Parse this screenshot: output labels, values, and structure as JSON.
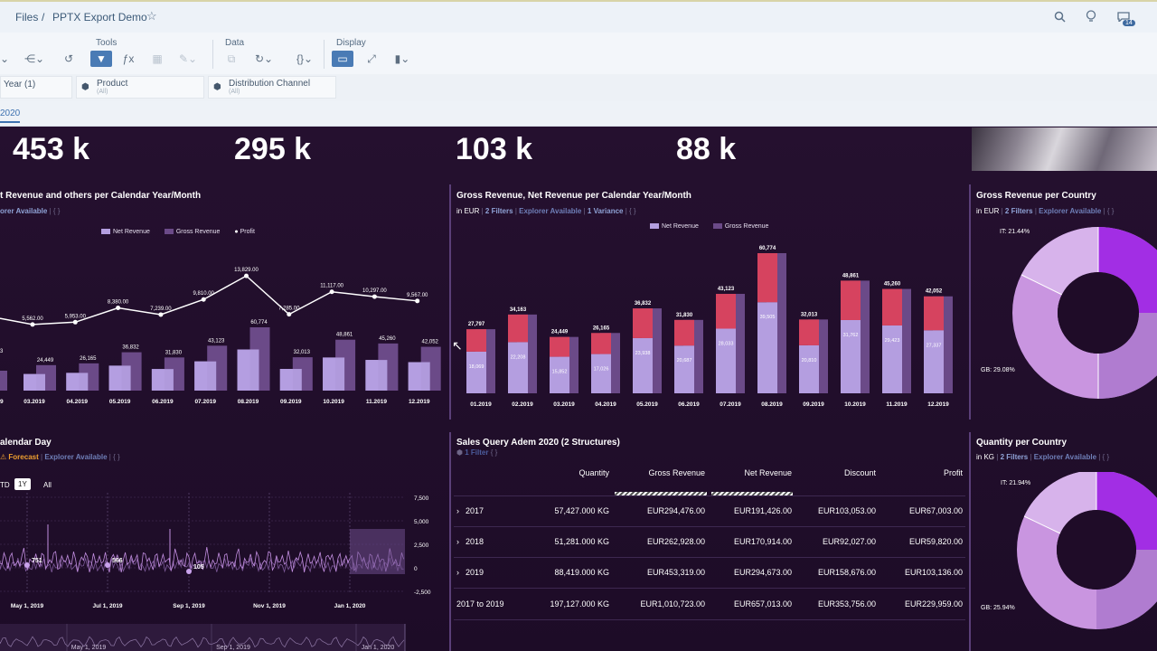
{
  "breadcrumb": {
    "root": "Files",
    "sep": "/",
    "current": "PPTX Export Demo"
  },
  "header_icons": [
    "search-icon",
    "lightbulb-icon",
    "notifications-icon"
  ],
  "notification_count": "14",
  "toolbar": {
    "tools_label": "Tools",
    "data_label": "Data",
    "display_label": "Display"
  },
  "filters": [
    {
      "title": "Year (1)",
      "sub": ""
    },
    {
      "title": "Product",
      "sub": "(All)"
    },
    {
      "title": "Distribution Channel",
      "sub": "(All)"
    }
  ],
  "page_tab": "2020",
  "kpis": [
    "453 k",
    "295 k",
    "103 k",
    "88 k"
  ],
  "widget1": {
    "title": "t Revenue and others per Calendar Year/Month",
    "sub_explorer": "orer Available",
    "legend": [
      "Net Revenue",
      "Gross Revenue",
      "Profit"
    ]
  },
  "widget2": {
    "title": "Gross Revenue, Net Revenue per Calendar Year/Month",
    "unit": "in EUR",
    "filters": "2 Filters",
    "explorer": "Explorer Available",
    "variance": "1 Variance",
    "legend": [
      "Net Revenue",
      "Gross Revenue"
    ]
  },
  "widget3": {
    "title": "Gross Revenue per Country",
    "unit": "in EUR",
    "filters": "2 Filters",
    "explorer": "Explorer Available",
    "labels": [
      "IT: 21.44%",
      "GB: 29.08%"
    ]
  },
  "widget4": {
    "title": "alendar Day",
    "forecast": "Forecast",
    "explorer": "Explorer Available",
    "ranges": [
      "TD",
      "1Y",
      "All"
    ],
    "y_ticks": [
      "7,500",
      "5,000",
      "2,500",
      "0",
      "-2,500"
    ],
    "x_ticks": [
      "May 1, 2019",
      "Jul 1, 2019",
      "Sep 1, 2019",
      "Nov 1, 2019",
      "Jan 1, 2020"
    ],
    "nav_ticks": [
      "May 1, 2019",
      "Sep 1, 2019",
      "Jan 1, 2020"
    ],
    "points": [
      "751",
      "566",
      "105"
    ]
  },
  "widget5": {
    "title": "Sales Query Adem 2020 (2 Structures)",
    "filter": "1 Filter",
    "columns": [
      "Quantity",
      "Gross Revenue",
      "Net Revenue",
      "Discount",
      "Profit"
    ],
    "rows": [
      {
        "label": "2017",
        "cells": [
          "57,427.000 KG",
          "EUR294,476.00",
          "EUR191,426.00",
          "EUR103,053.00",
          "EUR67,003.00"
        ]
      },
      {
        "label": "2018",
        "cells": [
          "51,281.000 KG",
          "EUR262,928.00",
          "EUR170,914.00",
          "EUR92,027.00",
          "EUR59,820.00"
        ]
      },
      {
        "label": "2019",
        "cells": [
          "88,419.000 KG",
          "EUR453,319.00",
          "EUR294,673.00",
          "EUR158,676.00",
          "EUR103,136.00"
        ]
      },
      {
        "label": "2017 to 2019",
        "cells": [
          "197,127.000 KG",
          "EUR1,010,723.00",
          "EUR657,013.00",
          "EUR353,756.00",
          "EUR229,959.00"
        ]
      }
    ]
  },
  "widget6": {
    "title": "Quantity per Country",
    "unit": "in KG",
    "filters": "2 Filters",
    "explorer": "Explorer Available",
    "labels": [
      "IT: 21.94%",
      "GB: 25.94%"
    ]
  },
  "colors": {
    "net": "#b49ee0",
    "gross": "#6b4a88",
    "red": "#d6435f",
    "profit": "#ffffff",
    "purple": "#a22ee4",
    "lilac": "#c995e0"
  },
  "chart_data": [
    {
      "type": "bar",
      "title": "t Revenue and others per Calendar Year/Month",
      "categories": [
        "03.2019",
        "04.2019",
        "05.2019",
        "06.2019",
        "07.2019",
        "08.2019",
        "09.2019",
        "10.2019",
        "11.2019",
        "12.2019"
      ],
      "series": [
        {
          "name": "Gross Revenue",
          "values": [
            24449,
            26165,
            36832,
            31830,
            43123,
            60774,
            32013,
            48861,
            45260,
            42052
          ]
        },
        {
          "name": "Profit",
          "values": [
            5562,
            5953,
            8380,
            7239,
            9810,
            13829,
            7285,
            11117,
            10297,
            9567
          ]
        }
      ]
    },
    {
      "type": "bar",
      "title": "Gross Revenue, Net Revenue per Calendar Year/Month",
      "categories": [
        "01.2019",
        "02.2019",
        "03.2019",
        "04.2019",
        "05.2019",
        "06.2019",
        "07.2019",
        "08.2019",
        "09.2019",
        "10.2019",
        "11.2019",
        "12.2019"
      ],
      "series": [
        {
          "name": "Net Revenue",
          "values": [
            18069,
            22208,
            15852,
            17026,
            23938,
            20687,
            28033,
            39505,
            20810,
            31762,
            29423,
            27337
          ]
        },
        {
          "name": "Gross Revenue",
          "values": [
            27797,
            34163,
            24449,
            26165,
            36832,
            31830,
            43123,
            60774,
            32013,
            48861,
            45260,
            42052
          ]
        }
      ]
    },
    {
      "type": "pie",
      "title": "Gross Revenue per Country",
      "labels": [
        "IT",
        "GB"
      ],
      "values": [
        21.44,
        29.08
      ]
    },
    {
      "type": "pie",
      "title": "Quantity per Country",
      "labels": [
        "IT",
        "GB"
      ],
      "values": [
        21.94,
        25.94
      ]
    }
  ]
}
